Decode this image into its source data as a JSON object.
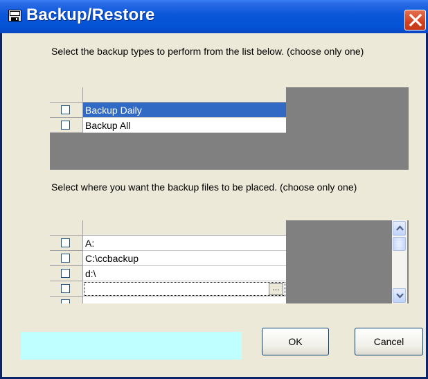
{
  "window": {
    "title": "Backup/Restore",
    "icon": "floppy-disk-icon",
    "close_icon": "close-icon"
  },
  "backup_types": {
    "instruction": "Select the backup types to perform from the list below.  (choose only one)",
    "rows": [
      {
        "label": "Backup Daily",
        "checked": false,
        "selected": true
      },
      {
        "label": "Backup All",
        "checked": false,
        "selected": false
      }
    ]
  },
  "destination": {
    "instruction": "Select where you want the backup files to be placed.  (choose only one)",
    "rows": [
      {
        "label": "A:",
        "checked": false
      },
      {
        "label": "C:\\ccbackup",
        "checked": false
      },
      {
        "label": "d:\\",
        "checked": false
      },
      {
        "label": "",
        "checked": false,
        "editing": true
      }
    ],
    "ellipsis_label": "..."
  },
  "buttons": {
    "ok": "OK",
    "cancel": "Cancel"
  },
  "status_text": "",
  "colors": {
    "selection": "#316ac5",
    "grid_background": "#808080",
    "status_panel": "#c0ffff",
    "titlebar": "#0453d6"
  }
}
